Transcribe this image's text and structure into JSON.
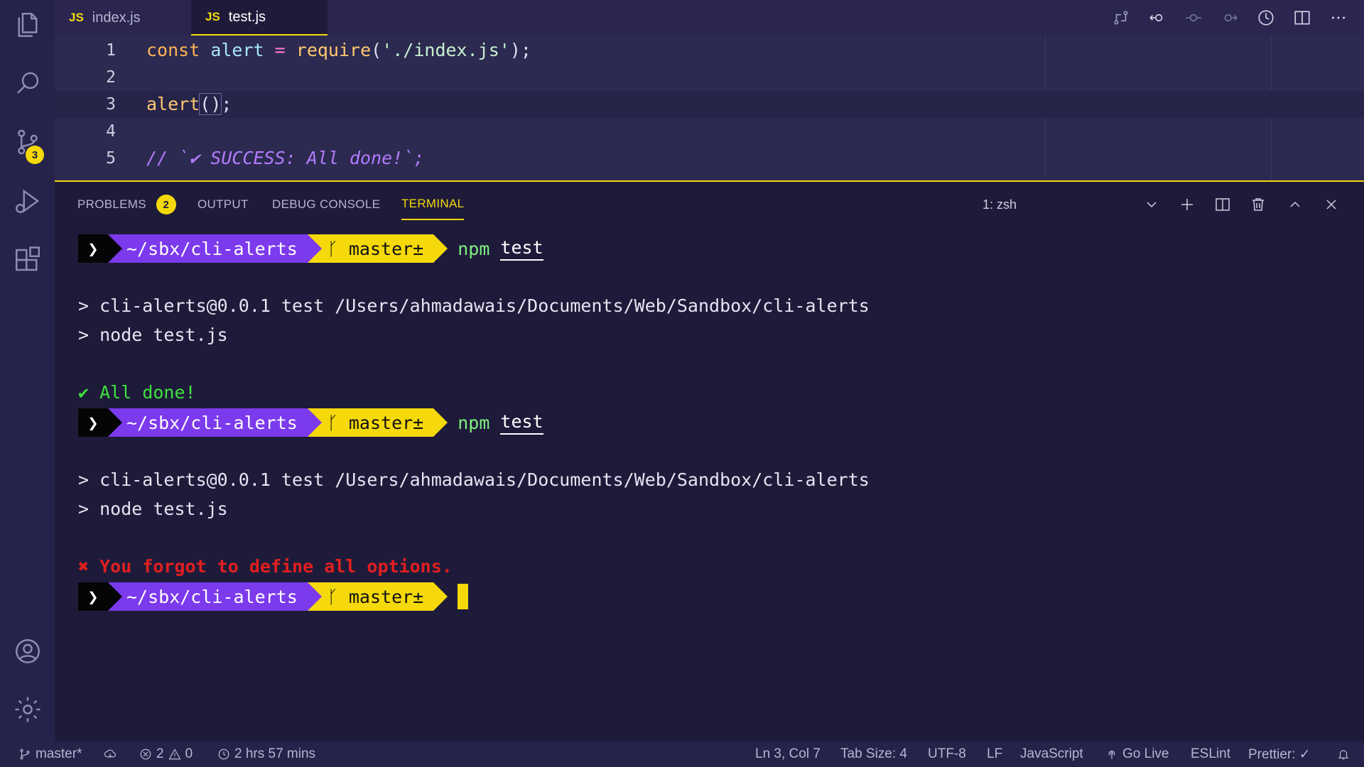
{
  "tabs": [
    {
      "icon": "JS",
      "label": "index.js"
    },
    {
      "icon": "JS",
      "label": "test.js"
    }
  ],
  "activity": {
    "source_control_badge": "3"
  },
  "editor": {
    "lines": [
      {
        "number": "1",
        "keyword": "const",
        "var": "alert",
        "op": "=",
        "fn": "require",
        "open": "(",
        "str": "'./index.js'",
        "close": ");"
      },
      {
        "number": "2"
      },
      {
        "number": "3",
        "fn": "alert",
        "parens": "()",
        "end": ";"
      },
      {
        "number": "4"
      },
      {
        "number": "5",
        "comment": "// `✔ SUCCESS: All done!`;"
      }
    ]
  },
  "panel": {
    "tabs": [
      "PROBLEMS",
      "OUTPUT",
      "DEBUG CONSOLE",
      "TERMINAL"
    ],
    "problems_count": "2",
    "terminal_select": "1: zsh"
  },
  "terminal": {
    "prompt_arrow": "❯",
    "prompt_path": "~/sbx/cli-alerts",
    "prompt_branch": "ᚴ master±",
    "cmd": "npm",
    "cmd_arg": "test",
    "run_line_1": "> cli-alerts@0.0.1 test /Users/ahmadawais/Documents/Web/Sandbox/cli-alerts",
    "run_line_2": "> node test.js",
    "success_icon": "✔",
    "success_text": "All done!",
    "error_icon": "✖",
    "error_text": "You forgot to define all options."
  },
  "status": {
    "branch": "master*",
    "errors": "2",
    "warnings": "0",
    "time": "2 hrs 57 mins",
    "position": "Ln 3, Col 7",
    "tab_size": "Tab Size: 4",
    "encoding": "UTF-8",
    "eol": "LF",
    "language": "JavaScript",
    "golive": "Go Live",
    "eslint": "ESLint",
    "prettier": "Prettier: ✓"
  }
}
